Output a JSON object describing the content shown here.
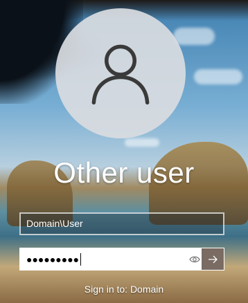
{
  "user": {
    "display_name": "Other user",
    "avatar_icon": "user-silhouette-icon"
  },
  "fields": {
    "username_value": "Domain\\User",
    "password_mask": "●●●●●●●●●"
  },
  "icons": {
    "reveal": "eye-icon",
    "submit": "arrow-right-icon"
  },
  "footer": {
    "sign_in_text": "Sign in to: Domain"
  },
  "colors": {
    "submit_bg": "#7a6b63",
    "avatar_bg": "#d8dce0"
  }
}
